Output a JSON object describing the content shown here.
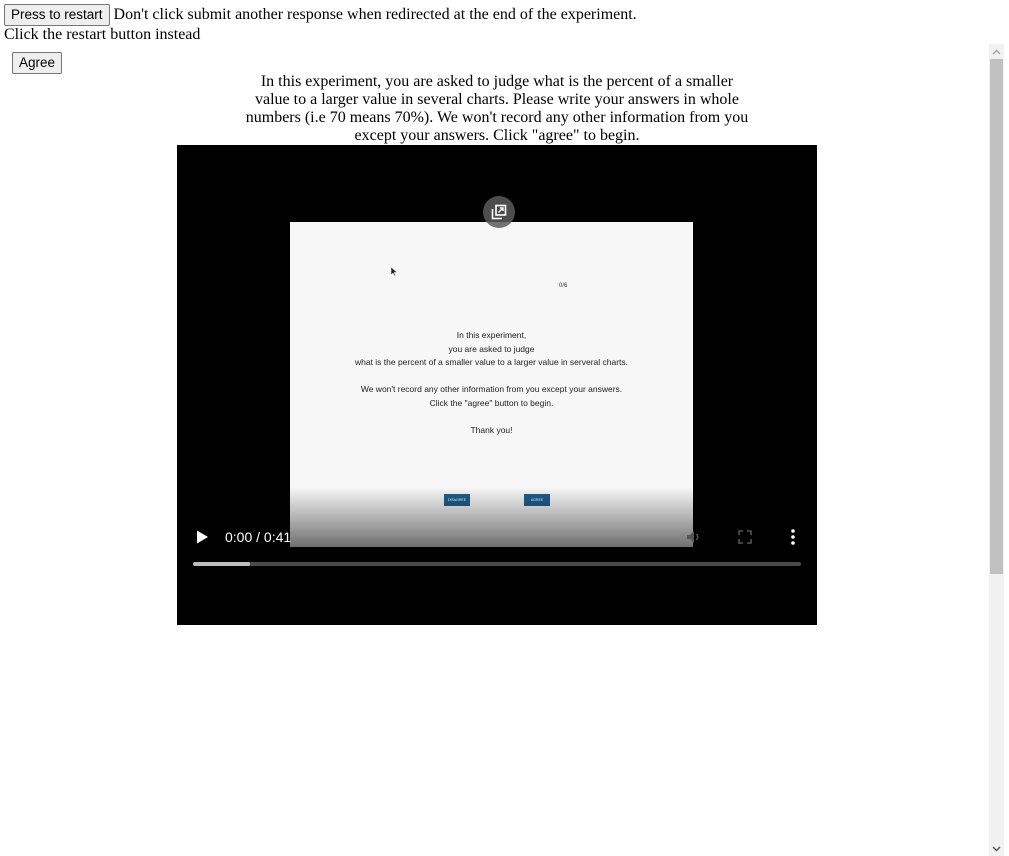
{
  "header": {
    "restart_button": "Press to restart",
    "warning": "Don't click submit another response when redirected at the end of the experiment.",
    "restart_note": "Click the restart button instead"
  },
  "survey": {
    "agree_button": "Agree",
    "instructions": "In this experiment, you are asked to judge what is the percent of a smaller value to a larger value in several charts. Please write your answers in whole numbers (i.e 70 means 70%). We won't record any other information from you except your answers. Click \"agree\" to begin."
  },
  "video": {
    "time": "0:00 / 0:41",
    "buffered_fraction": 0.094,
    "preview": {
      "counter": "0/6",
      "lines": [
        "In this experiment,",
        "you are asked to judge",
        "what is the percent of a smaller value to a larger value in serveral charts.",
        "We won't record any other information from you except your answers.",
        "Click the \"agree\" button to begin.",
        "Thank you!"
      ],
      "buttons": [
        "Disagree",
        "Agree"
      ]
    }
  },
  "icons": {
    "pip": "picture-in-picture-icon",
    "play": "play-icon",
    "mute": "volume-icon",
    "fullscreen": "fullscreen-icon",
    "more": "more-options-icon"
  }
}
